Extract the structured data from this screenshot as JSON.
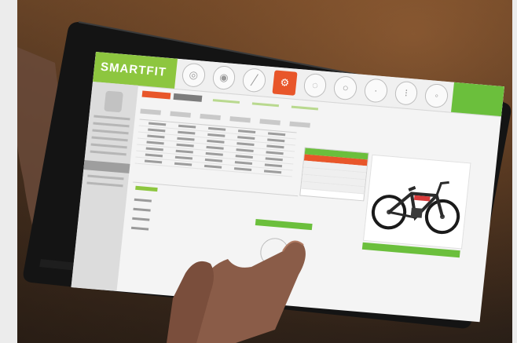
{
  "app": {
    "logo_text": "SMARTFIT"
  },
  "nav": {
    "icons": [
      "bike-icon",
      "person-icon",
      "ruler-icon",
      "saddle-icon",
      "handlebar-icon",
      "wheel-icon",
      "pedal-icon",
      "settings-icon",
      "info-icon"
    ],
    "active_index": 3
  },
  "colors": {
    "brand_green": "#8dc63f",
    "accent_orange": "#e8562a",
    "highlight_green": "#6bbf3c",
    "tablet_frame": "#141414"
  }
}
